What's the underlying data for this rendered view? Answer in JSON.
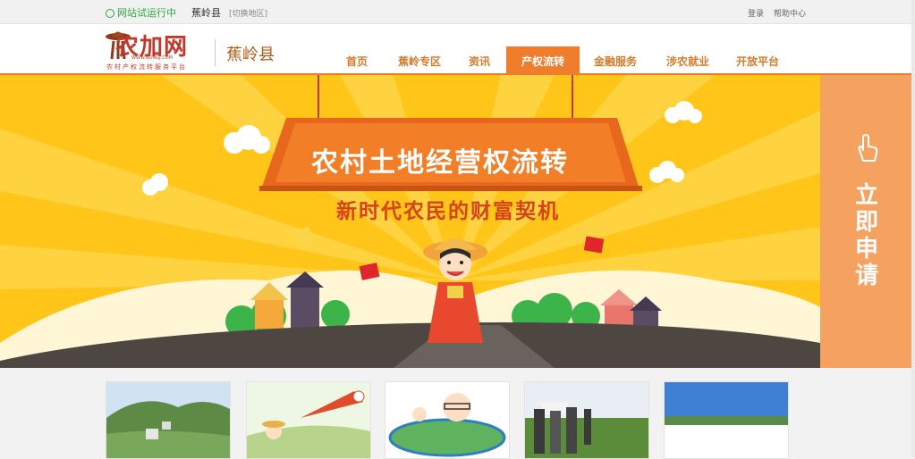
{
  "topbar": {
    "status": "网站试运行中",
    "county": "蕉岭县",
    "switch": "[切换地区]",
    "login": "登录",
    "help": "帮助中心"
  },
  "header": {
    "logo_main": "农加网",
    "logo_url": "WWW.NONGJ.COM",
    "logo_sub": "农村产权流转服务平台",
    "county": "蕉岭县"
  },
  "nav": {
    "items": [
      {
        "label": "首页"
      },
      {
        "label": "蕉岭专区"
      },
      {
        "label": "资讯"
      },
      {
        "label": "产权流转"
      },
      {
        "label": "金融服务"
      },
      {
        "label": "涉农就业"
      },
      {
        "label": "开放平台"
      }
    ],
    "active_index": 3
  },
  "banner": {
    "title": "农村土地经营权流转",
    "subtitle": "新时代农民的财富契机"
  },
  "apply": {
    "label": "立即申请",
    "icon": "hand-pointer-icon"
  },
  "thumbnails": {
    "count": 5
  },
  "colors": {
    "accent": "#f07d2c",
    "banner_bg": "#ffc619",
    "apply_bg": "#f5a160",
    "status_green": "#2aa83c"
  }
}
